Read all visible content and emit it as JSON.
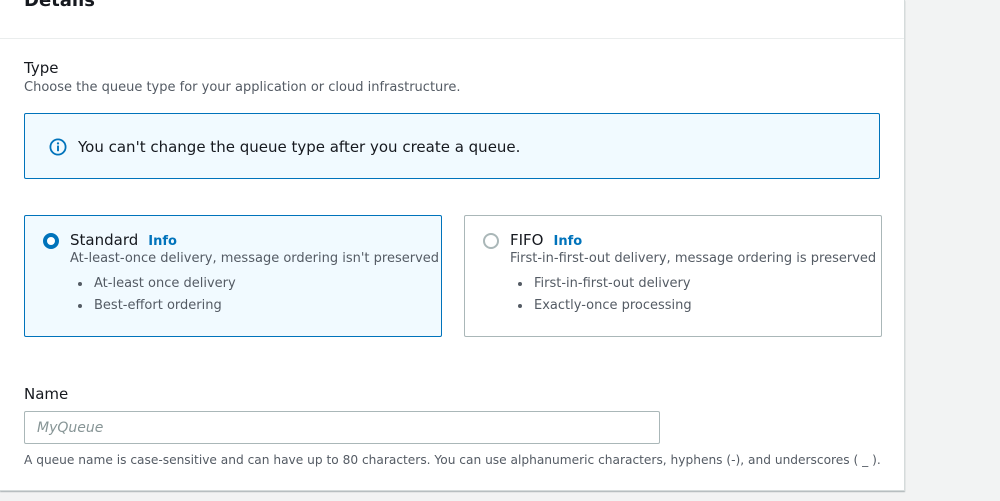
{
  "panel": {
    "title": "Details"
  },
  "type_section": {
    "label": "Type",
    "description": "Choose the queue type for your application or cloud infrastructure."
  },
  "alert": {
    "icon": "info-circle-icon",
    "text": "You can't change the queue type after you create a queue."
  },
  "queue_types": [
    {
      "title": "Standard",
      "info_label": "Info",
      "selected": true,
      "description": "At-least-once delivery, message ordering isn't preserved",
      "features": [
        "At-least once delivery",
        "Best-effort ordering"
      ]
    },
    {
      "title": "FIFO",
      "info_label": "Info",
      "selected": false,
      "description": "First-in-first-out delivery, message ordering is preserved",
      "features": [
        "First-in-first-out delivery",
        "Exactly-once processing"
      ]
    }
  ],
  "name_section": {
    "label": "Name",
    "value": "",
    "placeholder": "MyQueue",
    "hint": "A queue name is case-sensitive and can have up to 80 characters. You can use alphanumeric characters, hyphens (-), and underscores ( _ )."
  },
  "colors": {
    "accent": "#0073bb",
    "selected_background": "#f1faff",
    "border": "#aab7b8",
    "text_primary": "#16191f",
    "text_secondary": "#545b64",
    "page_background": "#f2f3f3"
  }
}
